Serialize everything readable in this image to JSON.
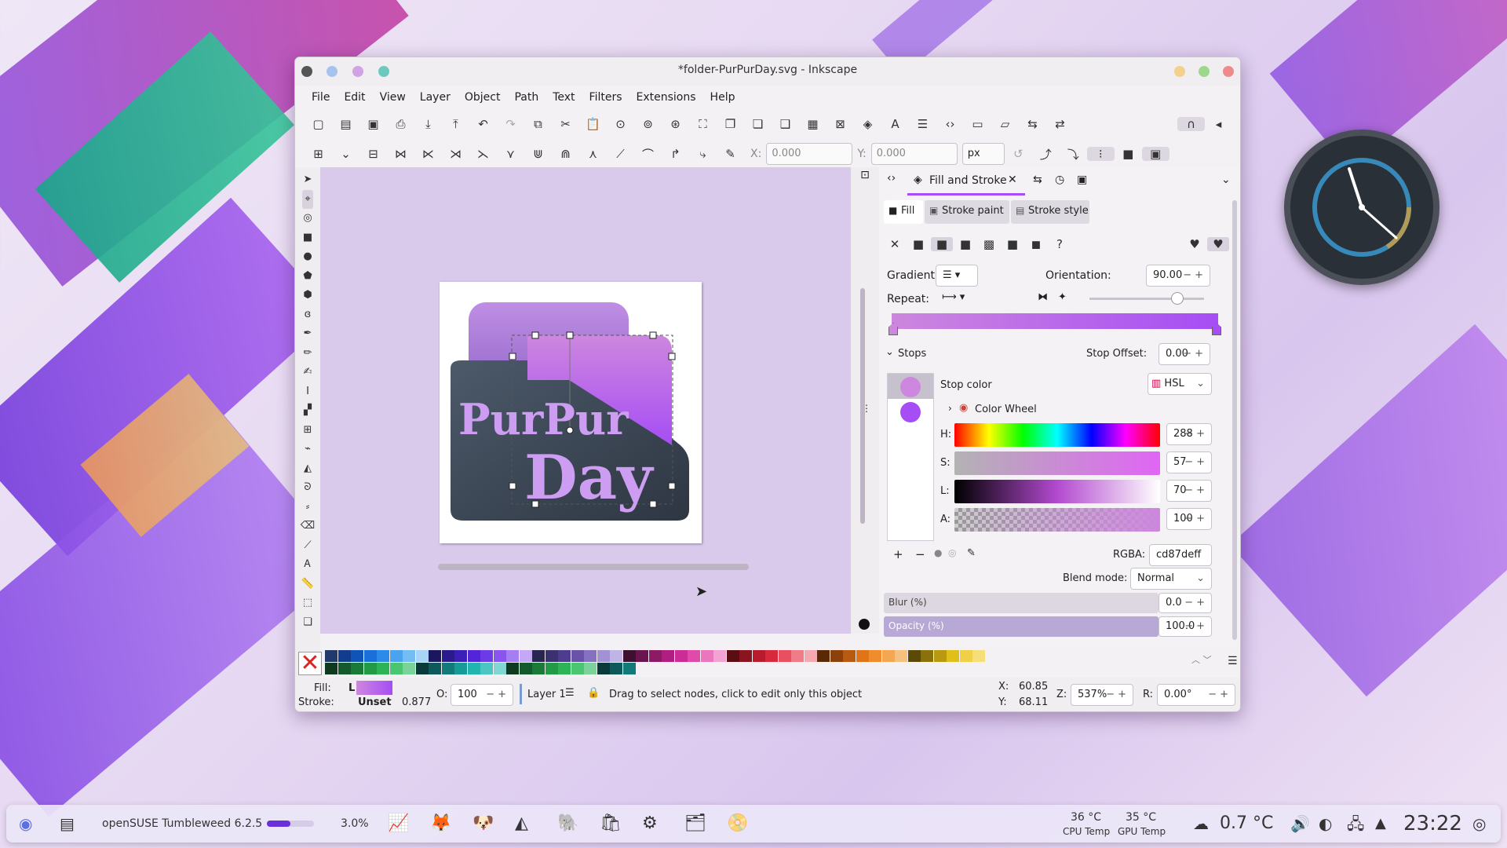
{
  "window": {
    "title": "*folder-PurPurDay.svg - Inkscape",
    "menu": [
      "File",
      "Edit",
      "View",
      "Layer",
      "Object",
      "Path",
      "Text",
      "Filters",
      "Extensions",
      "Help"
    ]
  },
  "node_toolbar": {
    "x_label": "X:",
    "x_value": "0.000",
    "y_label": "Y:",
    "y_value": "0.000",
    "unit": "px"
  },
  "artwork": {
    "word1": "PurPur",
    "word2": "Day"
  },
  "panel": {
    "tab_title": "Fill and Stroke",
    "subtabs": [
      "Fill",
      "Stroke paint",
      "Stroke style"
    ],
    "gradient_label": "Gradient:",
    "orientation_label": "Orientation:",
    "orientation_value": "90.00",
    "repeat_label": "Repeat:",
    "stops_label": "Stops",
    "stop_offset_label": "Stop Offset:",
    "stop_offset_value": "0.00",
    "stop_color_label": "Stop color",
    "color_mode": "HSL",
    "color_wheel_label": "Color Wheel",
    "h_label": "H:",
    "h_value": "288",
    "s_label": "S:",
    "s_value": "57",
    "l_label": "L:",
    "l_value": "70",
    "a_label": "A:",
    "a_value": "100",
    "rgba_label": "RGBA:",
    "rgba_value": "cd87deff",
    "blend_label": "Blend mode:",
    "blend_value": "Normal",
    "blur_label": "Blur (%)",
    "blur_value": "0.0",
    "opacity_label": "Opacity (%)",
    "opacity_value": "100.0"
  },
  "status": {
    "fill_label": "Fill:",
    "fill_type": "L",
    "stroke_label": "Stroke:",
    "stroke_value": "Unset",
    "stroke_width": "0.877",
    "opacity_label": "O:",
    "opacity_value": "100",
    "layer": "Layer 1",
    "message": "Drag to select nodes, click to edit only this object",
    "x_label": "X:",
    "x": "60.85",
    "y_label": "Y:",
    "y": "68.11",
    "zoom_label": "Z:",
    "zoom": "537%",
    "rot_label": "R:",
    "rotation": "0.00°"
  },
  "taskbar": {
    "distro": "openSUSE Tumbleweed 6.2.5",
    "cpu_usage": "3.0%",
    "cpu_temp": "36 °C",
    "cpu_temp_label": "CPU Temp",
    "gpu_temp": "35 °C",
    "gpu_temp_label": "GPU Temp",
    "weather": "0.7 °C",
    "time": "23:22"
  },
  "colors": {
    "accent": "#cd87de",
    "stop2": "#a64df5",
    "canvas": "#d9caec",
    "dark": "#3a4656"
  }
}
